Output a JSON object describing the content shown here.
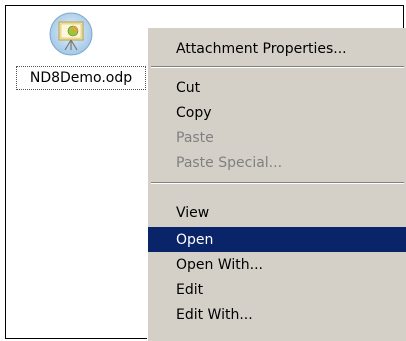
{
  "file": {
    "name": "ND8Demo.odp",
    "icon": "presentation-icon"
  },
  "context_menu": {
    "items": [
      {
        "label": "Attachment Properties...",
        "state": "enabled"
      },
      {
        "label": "Cut",
        "state": "enabled"
      },
      {
        "label": "Copy",
        "state": "enabled"
      },
      {
        "label": "Paste",
        "state": "disabled"
      },
      {
        "label": "Paste Special...",
        "state": "disabled"
      },
      {
        "label": "View",
        "state": "enabled"
      },
      {
        "label": "Open",
        "state": "highlighted"
      },
      {
        "label": "Open With...",
        "state": "enabled"
      },
      {
        "label": "Edit",
        "state": "enabled"
      },
      {
        "label": "Edit With...",
        "state": "enabled"
      }
    ]
  },
  "colors": {
    "menu_background": "#d4d0c8",
    "highlight_background": "#0a246a",
    "highlight_text": "#ffffff",
    "disabled_text": "#808080"
  }
}
